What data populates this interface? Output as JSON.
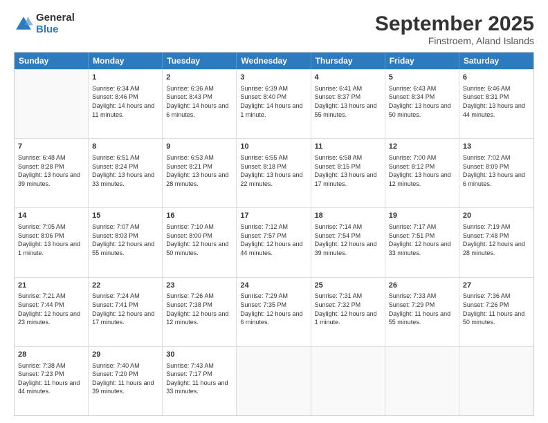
{
  "logo": {
    "general": "General",
    "blue": "Blue"
  },
  "title": "September 2025",
  "subtitle": "Finstroem, Aland Islands",
  "headers": [
    "Sunday",
    "Monday",
    "Tuesday",
    "Wednesday",
    "Thursday",
    "Friday",
    "Saturday"
  ],
  "weeks": [
    [
      {
        "day": "",
        "empty": true
      },
      {
        "day": "1",
        "sunrise": "6:34 AM",
        "sunset": "8:46 PM",
        "daylight": "14 hours and 11 minutes."
      },
      {
        "day": "2",
        "sunrise": "6:36 AM",
        "sunset": "8:43 PM",
        "daylight": "14 hours and 6 minutes."
      },
      {
        "day": "3",
        "sunrise": "6:39 AM",
        "sunset": "8:40 PM",
        "daylight": "14 hours and 1 minute."
      },
      {
        "day": "4",
        "sunrise": "6:41 AM",
        "sunset": "8:37 PM",
        "daylight": "13 hours and 55 minutes."
      },
      {
        "day": "5",
        "sunrise": "6:43 AM",
        "sunset": "8:34 PM",
        "daylight": "13 hours and 50 minutes."
      },
      {
        "day": "6",
        "sunrise": "6:46 AM",
        "sunset": "8:31 PM",
        "daylight": "13 hours and 44 minutes."
      }
    ],
    [
      {
        "day": "7",
        "sunrise": "6:48 AM",
        "sunset": "8:28 PM",
        "daylight": "13 hours and 39 minutes."
      },
      {
        "day": "8",
        "sunrise": "6:51 AM",
        "sunset": "8:24 PM",
        "daylight": "13 hours and 33 minutes."
      },
      {
        "day": "9",
        "sunrise": "6:53 AM",
        "sunset": "8:21 PM",
        "daylight": "13 hours and 28 minutes."
      },
      {
        "day": "10",
        "sunrise": "6:55 AM",
        "sunset": "8:18 PM",
        "daylight": "13 hours and 22 minutes."
      },
      {
        "day": "11",
        "sunrise": "6:58 AM",
        "sunset": "8:15 PM",
        "daylight": "13 hours and 17 minutes."
      },
      {
        "day": "12",
        "sunrise": "7:00 AM",
        "sunset": "8:12 PM",
        "daylight": "13 hours and 12 minutes."
      },
      {
        "day": "13",
        "sunrise": "7:02 AM",
        "sunset": "8:09 PM",
        "daylight": "13 hours and 6 minutes."
      }
    ],
    [
      {
        "day": "14",
        "sunrise": "7:05 AM",
        "sunset": "8:06 PM",
        "daylight": "13 hours and 1 minute."
      },
      {
        "day": "15",
        "sunrise": "7:07 AM",
        "sunset": "8:03 PM",
        "daylight": "12 hours and 55 minutes."
      },
      {
        "day": "16",
        "sunrise": "7:10 AM",
        "sunset": "8:00 PM",
        "daylight": "12 hours and 50 minutes."
      },
      {
        "day": "17",
        "sunrise": "7:12 AM",
        "sunset": "7:57 PM",
        "daylight": "12 hours and 44 minutes."
      },
      {
        "day": "18",
        "sunrise": "7:14 AM",
        "sunset": "7:54 PM",
        "daylight": "12 hours and 39 minutes."
      },
      {
        "day": "19",
        "sunrise": "7:17 AM",
        "sunset": "7:51 PM",
        "daylight": "12 hours and 33 minutes."
      },
      {
        "day": "20",
        "sunrise": "7:19 AM",
        "sunset": "7:48 PM",
        "daylight": "12 hours and 28 minutes."
      }
    ],
    [
      {
        "day": "21",
        "sunrise": "7:21 AM",
        "sunset": "7:44 PM",
        "daylight": "12 hours and 23 minutes."
      },
      {
        "day": "22",
        "sunrise": "7:24 AM",
        "sunset": "7:41 PM",
        "daylight": "12 hours and 17 minutes."
      },
      {
        "day": "23",
        "sunrise": "7:26 AM",
        "sunset": "7:38 PM",
        "daylight": "12 hours and 12 minutes."
      },
      {
        "day": "24",
        "sunrise": "7:29 AM",
        "sunset": "7:35 PM",
        "daylight": "12 hours and 6 minutes."
      },
      {
        "day": "25",
        "sunrise": "7:31 AM",
        "sunset": "7:32 PM",
        "daylight": "12 hours and 1 minute."
      },
      {
        "day": "26",
        "sunrise": "7:33 AM",
        "sunset": "7:29 PM",
        "daylight": "11 hours and 55 minutes."
      },
      {
        "day": "27",
        "sunrise": "7:36 AM",
        "sunset": "7:26 PM",
        "daylight": "11 hours and 50 minutes."
      }
    ],
    [
      {
        "day": "28",
        "sunrise": "7:38 AM",
        "sunset": "7:23 PM",
        "daylight": "11 hours and 44 minutes."
      },
      {
        "day": "29",
        "sunrise": "7:40 AM",
        "sunset": "7:20 PM",
        "daylight": "11 hours and 39 minutes."
      },
      {
        "day": "30",
        "sunrise": "7:43 AM",
        "sunset": "7:17 PM",
        "daylight": "11 hours and 33 minutes."
      },
      {
        "day": "",
        "empty": true
      },
      {
        "day": "",
        "empty": true
      },
      {
        "day": "",
        "empty": true
      },
      {
        "day": "",
        "empty": true
      }
    ]
  ]
}
